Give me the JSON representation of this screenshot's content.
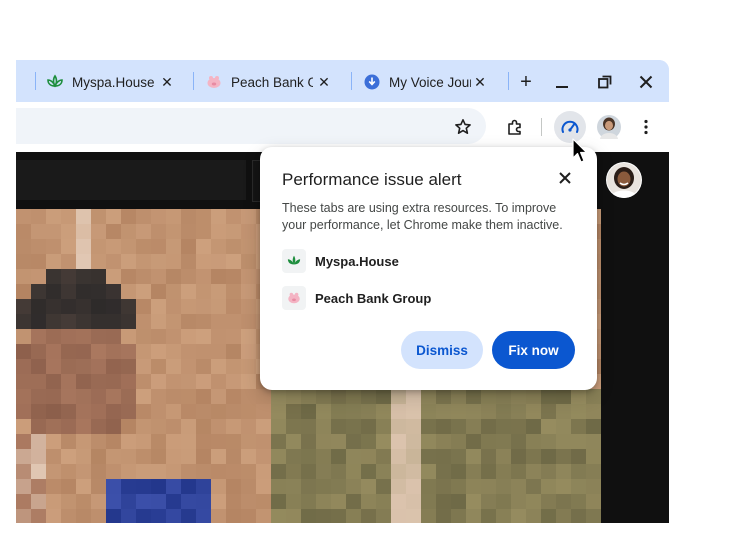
{
  "tabs": [
    {
      "title": "Myspa.House",
      "icon": "lotus-icon"
    },
    {
      "title": "Peach Bank Gr",
      "icon": "piggy-bank-icon"
    },
    {
      "title": "My Voice Journ",
      "icon": "download-circle-icon"
    }
  ],
  "tab_close_glyph": "✕",
  "new_tab_label": "+",
  "window_controls": [
    "minimize-icon",
    "restore-icon",
    "close-icon"
  ],
  "toolbar_icons": [
    "star-icon",
    "extensions-icon",
    "performance-gauge-icon",
    "profile-avatar",
    "more-menu-icon"
  ],
  "popup": {
    "title": "Performance issue alert",
    "description": "These tabs are using extra resources. To improve your performance, let Chrome make them inactive.",
    "tabs": [
      {
        "name": "Myspa.House",
        "icon": "lotus-icon"
      },
      {
        "name": "Peach Bank Group",
        "icon": "piggy-bank-icon"
      }
    ],
    "dismiss_label": "Dismiss",
    "fix_label": "Fix now"
  },
  "colors": {
    "tabstrip": "#d3e3fd",
    "accent": "#0b57d0",
    "lotus": "#1e8e3e",
    "piggy": "#f4b4c4",
    "download": "#3c6fd8"
  }
}
